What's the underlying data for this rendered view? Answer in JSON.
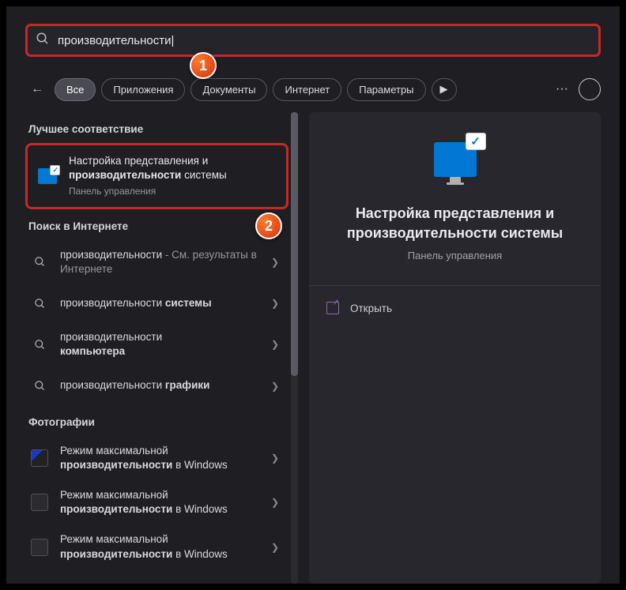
{
  "search": {
    "value": "производительности"
  },
  "tabs": {
    "all": "Все",
    "apps": "Приложения",
    "docs": "Документы",
    "internet": "Интернет",
    "params": "Параметры"
  },
  "sections": {
    "best": "Лучшее соответствие",
    "web": "Поиск в Интернете",
    "photos": "Фотографии"
  },
  "bestMatch": {
    "line1": "Настройка представления и",
    "boldPart": "производительности",
    "line2suffix": " системы",
    "subtitle": "Панель управления"
  },
  "web1": {
    "text": "производительности",
    "suffix": " - См. результаты в Интернете"
  },
  "web2": {
    "prefix": "производительности ",
    "bold": "системы"
  },
  "web3": {
    "prefix": "производительности ",
    "bold": "компьютера"
  },
  "web4": {
    "prefix": "производительности ",
    "bold": "графики"
  },
  "photo1": {
    "l1": "Режим максимальной",
    "bold": "производительности",
    "suffix": " в Windows"
  },
  "photo2": {
    "l1": "Режим максимальной",
    "bold": "производительности",
    "suffix": " в Windows"
  },
  "photo3": {
    "l1": "Режим максимальной",
    "bold": "производительности",
    "suffix": " в Windows"
  },
  "preview": {
    "title": "Настройка представления и производительности системы",
    "subtitle": "Панель управления",
    "open": "Открыть"
  },
  "badges": {
    "one": "1",
    "two": "2"
  }
}
